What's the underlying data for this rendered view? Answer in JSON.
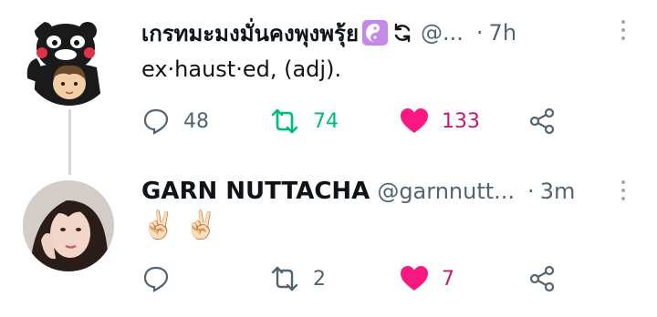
{
  "tweets": [
    {
      "display_name": "เกรทมะมงมั่นคงพุงพรุ้ย",
      "handle": "@...",
      "separator": "·",
      "time": "7h",
      "text": "ex·haust·ed, (adj).",
      "reply_count": "",
      "replies": "48",
      "retweets": "74",
      "likes": "133",
      "retweeted": true,
      "liked": true,
      "badge_icon": "yin-yang-icon"
    },
    {
      "display_name": "GARN NUTTACHA",
      "handle": "@garnnutt...",
      "separator": "·",
      "time": "3m",
      "text": "✌🏻 ✌🏻",
      "replies": "",
      "retweets": "2",
      "likes": "7",
      "retweeted": false,
      "liked": true
    }
  ],
  "colors": {
    "retweet_active": "#00ba7c",
    "like_active": "#f91880",
    "like_count": "#c8186d",
    "icon_gray": "#536471",
    "thread_line": "#cfd9de"
  }
}
